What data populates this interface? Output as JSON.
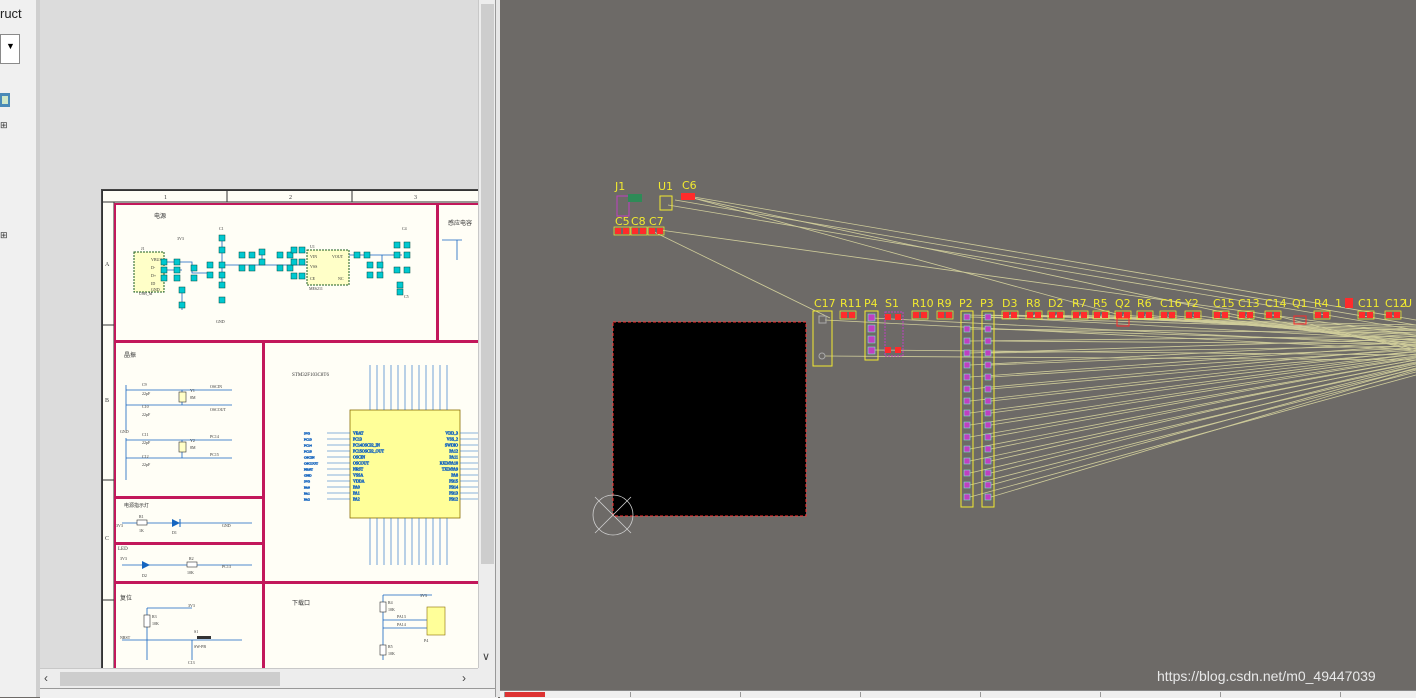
{
  "left_panel": {
    "title": "ruct"
  },
  "schematic": {
    "columns": [
      "1",
      "2",
      "3"
    ],
    "rows": [
      "A",
      "B",
      "C"
    ],
    "sections": {
      "power": "电源",
      "crystal": "晶振",
      "power_led": "电源指示灯",
      "led": "LED",
      "reset": "复位",
      "download": "下载口",
      "sensor": "感应电容"
    },
    "mcu": {
      "title": "STM32F103C8T6",
      "left_pins": [
        "VBAT",
        "PC13",
        "PC14OSC32_IN",
        "PC15OSC32_OUT",
        "OSCIN",
        "OSCOUT",
        "NRST",
        "VSSA",
        "VDDA",
        "PA0",
        "PA1",
        "PA2"
      ],
      "right_pins": [
        "VDD_3",
        "VSS_2",
        "SWDIO",
        "PA12",
        "PA11",
        "RXD/PA10",
        "TXD/PA9",
        "PA8",
        "PB15",
        "PB14",
        "PB13",
        "PB12"
      ],
      "left_nets": [
        "3V3",
        "PC13",
        "PC14",
        "PC15",
        "OSCIN",
        "OSCOUT",
        "NRST",
        "GND",
        "3V3",
        "PA0",
        "PA1",
        "PA2"
      ]
    },
    "regulator": {
      "ref": "U1",
      "part": "ME6211",
      "pins": [
        "VIN",
        "VSS",
        "CE",
        "VOUT",
        "NC"
      ]
    },
    "usb": {
      "ref": "J1",
      "part": "USB_M",
      "pins": [
        "VBUS",
        "D-",
        "D+",
        "ID",
        "GND"
      ]
    },
    "crystal_parts": [
      "C9",
      "22pF",
      "C10",
      "22pF",
      "Y1",
      "8M",
      "C11",
      "22pF",
      "C12",
      "22pF",
      "Y2",
      "8M"
    ],
    "crystal_nets": [
      "OSCIN",
      "OSCOUT",
      "PC14",
      "PC15",
      "GND"
    ],
    "power_led_parts": [
      "3V3",
      "R1",
      "1K",
      "D1",
      "GND"
    ],
    "led_parts": [
      "3V3",
      "D2",
      "R2",
      "10K",
      "PC13"
    ],
    "reset_parts": [
      "3V3",
      "R3",
      "10K",
      "NRST",
      "S1",
      "SW-PB",
      "C13"
    ],
    "download_parts": [
      "3V3",
      "R4",
      "10K",
      "R5",
      "10K",
      "PA13",
      "PA14",
      "P4"
    ],
    "labels": [
      "3V3",
      "GND",
      "C1",
      "C2",
      "C3",
      "C4",
      "C5",
      "C6",
      "C7",
      "C8"
    ]
  },
  "pcb": {
    "components_top": [
      "J1",
      "U1",
      "C6"
    ],
    "components_top_row2": [
      "C5",
      "C8",
      "C7"
    ],
    "components_row": [
      "C17",
      "R11",
      "P4",
      "S1",
      "R10",
      "R9",
      "P2",
      "P3",
      "D3",
      "R8",
      "D2",
      "R7",
      "R5",
      "Q2",
      "R6",
      "C16",
      "Y2",
      "C15",
      "C13",
      "C14",
      "Q1",
      "R4",
      "1",
      "C11",
      "C12",
      "U"
    ],
    "colors": {
      "background": "#6d6a67",
      "designator": "#f2ea2f",
      "ratsnest": "#cfcc9a",
      "pad": "#ff2b2b",
      "pin": "#c040c0",
      "board": "#000000"
    }
  },
  "watermark": "https://blog.csdn.net/m0_49447039"
}
